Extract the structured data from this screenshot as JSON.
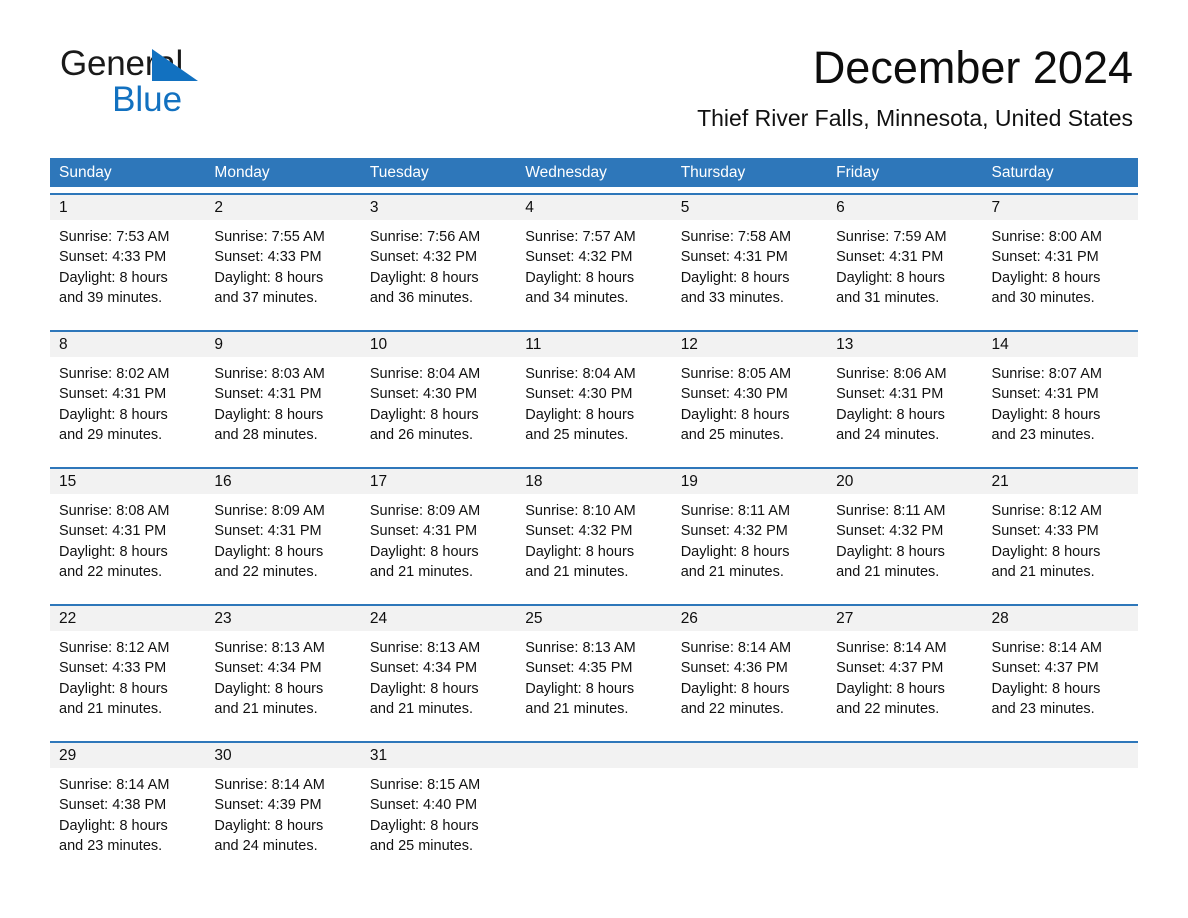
{
  "brand": {
    "line1": "General",
    "line2": "Blue",
    "mark": "triangle-logo",
    "color_dark": "#1a1a1a",
    "color_blue": "#1271c0"
  },
  "header": {
    "month_title": "December 2024",
    "location": "Thief River Falls, Minnesota, United States"
  },
  "theme": {
    "header_blue": "#2e77ba",
    "rule_blue": "#2e77ba",
    "daynum_band": "#f2f2f2",
    "page_background": "#ffffff",
    "text": "#111111"
  },
  "weekdays": [
    "Sunday",
    "Monday",
    "Tuesday",
    "Wednesday",
    "Thursday",
    "Friday",
    "Saturday"
  ],
  "weeks": [
    [
      {
        "day": "1",
        "sunrise": "Sunrise: 7:53 AM",
        "sunset": "Sunset: 4:33 PM",
        "daylight1": "Daylight: 8 hours",
        "daylight2": "and 39 minutes."
      },
      {
        "day": "2",
        "sunrise": "Sunrise: 7:55 AM",
        "sunset": "Sunset: 4:33 PM",
        "daylight1": "Daylight: 8 hours",
        "daylight2": "and 37 minutes."
      },
      {
        "day": "3",
        "sunrise": "Sunrise: 7:56 AM",
        "sunset": "Sunset: 4:32 PM",
        "daylight1": "Daylight: 8 hours",
        "daylight2": "and 36 minutes."
      },
      {
        "day": "4",
        "sunrise": "Sunrise: 7:57 AM",
        "sunset": "Sunset: 4:32 PM",
        "daylight1": "Daylight: 8 hours",
        "daylight2": "and 34 minutes."
      },
      {
        "day": "5",
        "sunrise": "Sunrise: 7:58 AM",
        "sunset": "Sunset: 4:31 PM",
        "daylight1": "Daylight: 8 hours",
        "daylight2": "and 33 minutes."
      },
      {
        "day": "6",
        "sunrise": "Sunrise: 7:59 AM",
        "sunset": "Sunset: 4:31 PM",
        "daylight1": "Daylight: 8 hours",
        "daylight2": "and 31 minutes."
      },
      {
        "day": "7",
        "sunrise": "Sunrise: 8:00 AM",
        "sunset": "Sunset: 4:31 PM",
        "daylight1": "Daylight: 8 hours",
        "daylight2": "and 30 minutes."
      }
    ],
    [
      {
        "day": "8",
        "sunrise": "Sunrise: 8:02 AM",
        "sunset": "Sunset: 4:31 PM",
        "daylight1": "Daylight: 8 hours",
        "daylight2": "and 29 minutes."
      },
      {
        "day": "9",
        "sunrise": "Sunrise: 8:03 AM",
        "sunset": "Sunset: 4:31 PM",
        "daylight1": "Daylight: 8 hours",
        "daylight2": "and 28 minutes."
      },
      {
        "day": "10",
        "sunrise": "Sunrise: 8:04 AM",
        "sunset": "Sunset: 4:30 PM",
        "daylight1": "Daylight: 8 hours",
        "daylight2": "and 26 minutes."
      },
      {
        "day": "11",
        "sunrise": "Sunrise: 8:04 AM",
        "sunset": "Sunset: 4:30 PM",
        "daylight1": "Daylight: 8 hours",
        "daylight2": "and 25 minutes."
      },
      {
        "day": "12",
        "sunrise": "Sunrise: 8:05 AM",
        "sunset": "Sunset: 4:30 PM",
        "daylight1": "Daylight: 8 hours",
        "daylight2": "and 25 minutes."
      },
      {
        "day": "13",
        "sunrise": "Sunrise: 8:06 AM",
        "sunset": "Sunset: 4:31 PM",
        "daylight1": "Daylight: 8 hours",
        "daylight2": "and 24 minutes."
      },
      {
        "day": "14",
        "sunrise": "Sunrise: 8:07 AM",
        "sunset": "Sunset: 4:31 PM",
        "daylight1": "Daylight: 8 hours",
        "daylight2": "and 23 minutes."
      }
    ],
    [
      {
        "day": "15",
        "sunrise": "Sunrise: 8:08 AM",
        "sunset": "Sunset: 4:31 PM",
        "daylight1": "Daylight: 8 hours",
        "daylight2": "and 22 minutes."
      },
      {
        "day": "16",
        "sunrise": "Sunrise: 8:09 AM",
        "sunset": "Sunset: 4:31 PM",
        "daylight1": "Daylight: 8 hours",
        "daylight2": "and 22 minutes."
      },
      {
        "day": "17",
        "sunrise": "Sunrise: 8:09 AM",
        "sunset": "Sunset: 4:31 PM",
        "daylight1": "Daylight: 8 hours",
        "daylight2": "and 21 minutes."
      },
      {
        "day": "18",
        "sunrise": "Sunrise: 8:10 AM",
        "sunset": "Sunset: 4:32 PM",
        "daylight1": "Daylight: 8 hours",
        "daylight2": "and 21 minutes."
      },
      {
        "day": "19",
        "sunrise": "Sunrise: 8:11 AM",
        "sunset": "Sunset: 4:32 PM",
        "daylight1": "Daylight: 8 hours",
        "daylight2": "and 21 minutes."
      },
      {
        "day": "20",
        "sunrise": "Sunrise: 8:11 AM",
        "sunset": "Sunset: 4:32 PM",
        "daylight1": "Daylight: 8 hours",
        "daylight2": "and 21 minutes."
      },
      {
        "day": "21",
        "sunrise": "Sunrise: 8:12 AM",
        "sunset": "Sunset: 4:33 PM",
        "daylight1": "Daylight: 8 hours",
        "daylight2": "and 21 minutes."
      }
    ],
    [
      {
        "day": "22",
        "sunrise": "Sunrise: 8:12 AM",
        "sunset": "Sunset: 4:33 PM",
        "daylight1": "Daylight: 8 hours",
        "daylight2": "and 21 minutes."
      },
      {
        "day": "23",
        "sunrise": "Sunrise: 8:13 AM",
        "sunset": "Sunset: 4:34 PM",
        "daylight1": "Daylight: 8 hours",
        "daylight2": "and 21 minutes."
      },
      {
        "day": "24",
        "sunrise": "Sunrise: 8:13 AM",
        "sunset": "Sunset: 4:34 PM",
        "daylight1": "Daylight: 8 hours",
        "daylight2": "and 21 minutes."
      },
      {
        "day": "25",
        "sunrise": "Sunrise: 8:13 AM",
        "sunset": "Sunset: 4:35 PM",
        "daylight1": "Daylight: 8 hours",
        "daylight2": "and 21 minutes."
      },
      {
        "day": "26",
        "sunrise": "Sunrise: 8:14 AM",
        "sunset": "Sunset: 4:36 PM",
        "daylight1": "Daylight: 8 hours",
        "daylight2": "and 22 minutes."
      },
      {
        "day": "27",
        "sunrise": "Sunrise: 8:14 AM",
        "sunset": "Sunset: 4:37 PM",
        "daylight1": "Daylight: 8 hours",
        "daylight2": "and 22 minutes."
      },
      {
        "day": "28",
        "sunrise": "Sunrise: 8:14 AM",
        "sunset": "Sunset: 4:37 PM",
        "daylight1": "Daylight: 8 hours",
        "daylight2": "and 23 minutes."
      }
    ],
    [
      {
        "day": "29",
        "sunrise": "Sunrise: 8:14 AM",
        "sunset": "Sunset: 4:38 PM",
        "daylight1": "Daylight: 8 hours",
        "daylight2": "and 23 minutes."
      },
      {
        "day": "30",
        "sunrise": "Sunrise: 8:14 AM",
        "sunset": "Sunset: 4:39 PM",
        "daylight1": "Daylight: 8 hours",
        "daylight2": "and 24 minutes."
      },
      {
        "day": "31",
        "sunrise": "Sunrise: 8:15 AM",
        "sunset": "Sunset: 4:40 PM",
        "daylight1": "Daylight: 8 hours",
        "daylight2": "and 25 minutes."
      },
      {
        "day": "",
        "sunrise": "",
        "sunset": "",
        "daylight1": "",
        "daylight2": ""
      },
      {
        "day": "",
        "sunrise": "",
        "sunset": "",
        "daylight1": "",
        "daylight2": ""
      },
      {
        "day": "",
        "sunrise": "",
        "sunset": "",
        "daylight1": "",
        "daylight2": ""
      },
      {
        "day": "",
        "sunrise": "",
        "sunset": "",
        "daylight1": "",
        "daylight2": ""
      }
    ]
  ]
}
